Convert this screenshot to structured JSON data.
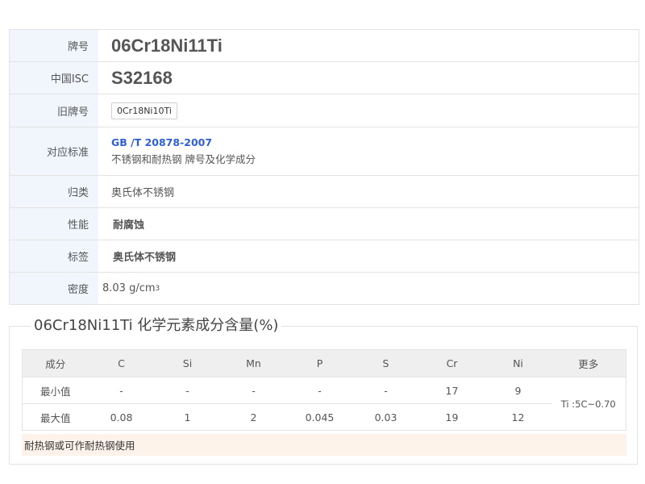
{
  "properties": {
    "grade_label": "牌号",
    "grade_value": "06Cr18Ni11Ti",
    "isc_label": "中国ISC",
    "isc_value": "S32168",
    "old_label": "旧牌号",
    "old_value": "0Cr18Ni10Ti",
    "standard_label": "对应标准",
    "standard_code": "GB /T 20878-2007",
    "standard_desc": "不锈钢和耐热钢 牌号及化学成分",
    "category_label": "归类",
    "category_value": "奥氏体不锈钢",
    "performance_label": "性能",
    "performance_value": "耐腐蚀",
    "tag_label": "标签",
    "tag_value": "奥氏体不锈钢",
    "density_label": "密度",
    "density_value": "8.03 g/cm",
    "density_sup": "3"
  },
  "composition": {
    "title": "06Cr18Ni11Ti 化学元素成分含量(%)",
    "headers": [
      "成分",
      "C",
      "Si",
      "Mn",
      "P",
      "S",
      "Cr",
      "Ni",
      "更多"
    ],
    "rows": [
      {
        "label": "最小值",
        "values": [
          "-",
          "-",
          "-",
          "-",
          "-",
          "17",
          "9"
        ]
      },
      {
        "label": "最大值",
        "values": [
          "0.08",
          "1",
          "2",
          "0.045",
          "0.03",
          "19",
          "12"
        ]
      }
    ],
    "more": "Ti :5C~0.70",
    "note": "耐热钢或可作耐热钢使用"
  },
  "colors": {
    "label_bg": "#f0f6fc",
    "link": "#2f5fd6",
    "note_bg": "#fdf3ea"
  }
}
